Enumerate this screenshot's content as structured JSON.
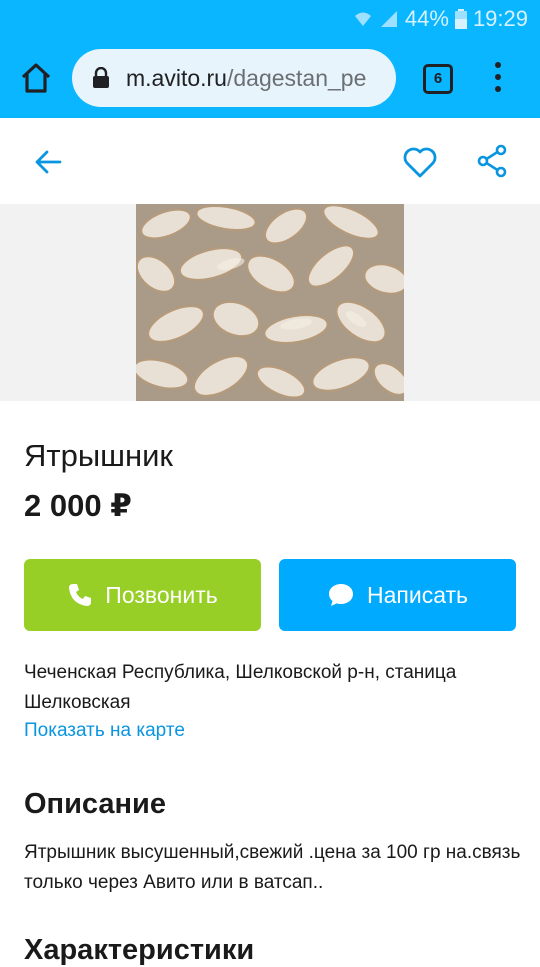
{
  "status_bar": {
    "battery": "44%",
    "time": "19:29"
  },
  "browser": {
    "url_domain": "m.avito.ru",
    "url_path": "/dagestan_pe",
    "tab_count": "6"
  },
  "listing": {
    "title": "Ятрышник",
    "price": "2 000 ₽",
    "call_label": "Позвонить",
    "write_label": "Написать",
    "address": "Чеченская Республика, Шелковской р-н, станица Шелковская",
    "map_link": "Показать на карте",
    "description_heading": "Описание",
    "description": "Ятрышник высушенный,свежий .цена за 100 гр на.связь только через Авито или в ватсап..",
    "characteristics_heading": "Характеристики"
  },
  "colors": {
    "browser_bar": "#0ab6ff",
    "call_button": "#97cf26",
    "write_button": "#00aaff",
    "link": "#0a95e0",
    "accent_icon": "#0a95e0"
  }
}
